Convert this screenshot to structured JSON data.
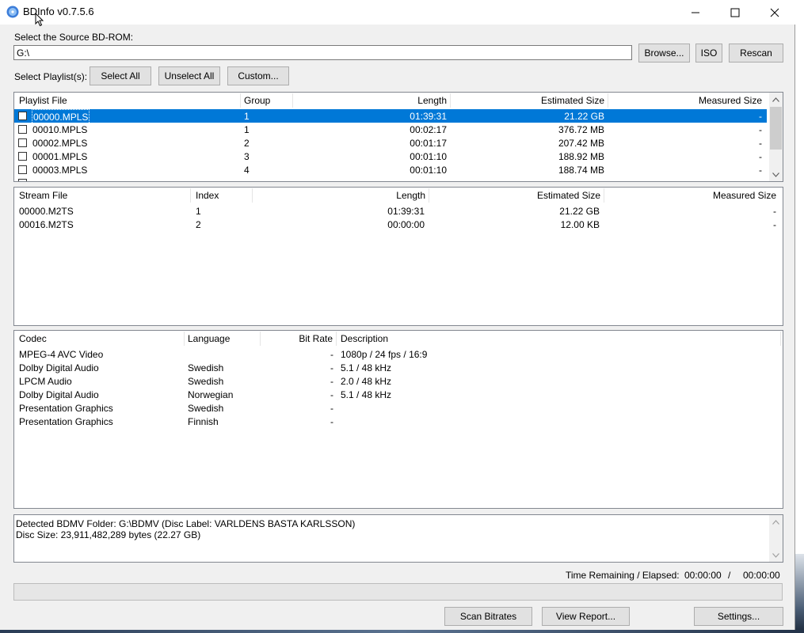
{
  "window": {
    "title": "BDInfo v0.7.5.6"
  },
  "source": {
    "label": "Select the Source BD-ROM:",
    "path": "G:\\",
    "browse": "Browse...",
    "iso": "ISO",
    "rescan": "Rescan"
  },
  "playlist_select": {
    "label": "Select Playlist(s):",
    "select_all": "Select All",
    "unselect_all": "Unselect All",
    "custom": "Custom..."
  },
  "playlists": {
    "headers": [
      "Playlist File",
      "Group",
      "Length",
      "Estimated Size",
      "Measured Size"
    ],
    "rows": [
      {
        "file": "00000.MPLS",
        "group": "1",
        "length": "01:39:31",
        "est": "21.22 GB",
        "meas": "-",
        "selected": true
      },
      {
        "file": "00010.MPLS",
        "group": "1",
        "length": "00:02:17",
        "est": "376.72 MB",
        "meas": "-",
        "selected": false
      },
      {
        "file": "00002.MPLS",
        "group": "2",
        "length": "00:01:17",
        "est": "207.42 MB",
        "meas": "-",
        "selected": false
      },
      {
        "file": "00001.MPLS",
        "group": "3",
        "length": "00:01:10",
        "est": "188.92 MB",
        "meas": "-",
        "selected": false
      },
      {
        "file": "00003.MPLS",
        "group": "4",
        "length": "00:01:10",
        "est": "188.74 MB",
        "meas": "-",
        "selected": false
      }
    ]
  },
  "streams": {
    "headers": [
      "Stream File",
      "Index",
      "Length",
      "Estimated Size",
      "Measured Size"
    ],
    "rows": [
      {
        "file": "00000.M2TS",
        "index": "1",
        "length": "01:39:31",
        "est": "21.22 GB",
        "meas": "-"
      },
      {
        "file": "00016.M2TS",
        "index": "2",
        "length": "00:00:00",
        "est": "12.00 KB",
        "meas": "-"
      }
    ]
  },
  "codecs": {
    "headers": [
      "Codec",
      "Language",
      "Bit Rate",
      "Description"
    ],
    "rows": [
      {
        "codec": "MPEG-4 AVC Video",
        "lang": "",
        "rate": "-",
        "desc": "1080p / 24 fps / 16:9"
      },
      {
        "codec": "Dolby Digital Audio",
        "lang": "Swedish",
        "rate": "-",
        "desc": "5.1 / 48 kHz"
      },
      {
        "codec": "LPCM Audio",
        "lang": "Swedish",
        "rate": "-",
        "desc": "2.0 / 48 kHz"
      },
      {
        "codec": "Dolby Digital Audio",
        "lang": "Norwegian",
        "rate": "-",
        "desc": "5.1 / 48 kHz"
      },
      {
        "codec": "Presentation Graphics",
        "lang": "Swedish",
        "rate": "-",
        "desc": ""
      },
      {
        "codec": "Presentation Graphics",
        "lang": "Finnish",
        "rate": "-",
        "desc": ""
      }
    ]
  },
  "status": {
    "line1": "Detected BDMV Folder: G:\\BDMV (Disc Label: VARLDENS BASTA KARLSSON)",
    "line2": "Disc Size: 23,911,482,289 bytes (22.27 GB)"
  },
  "time": {
    "label": "Time Remaining / Elapsed:",
    "remaining": "00:00:00",
    "sep": "/",
    "elapsed": "00:00:00"
  },
  "progress": {
    "value": 0
  },
  "bottom": {
    "scan": "Scan Bitrates",
    "report": "View Report...",
    "settings": "Settings..."
  },
  "colors": {
    "selection": "#0078d7",
    "window_bg": "#f0f0f0"
  }
}
